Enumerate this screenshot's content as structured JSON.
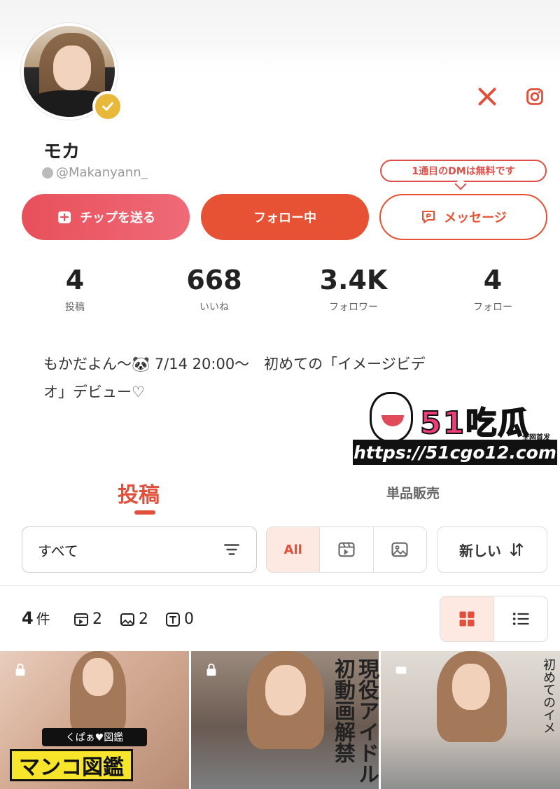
{
  "profile": {
    "name": "モカ",
    "handle": "@Makanyann_",
    "verified": true
  },
  "social": {
    "x_icon": "x-logo-icon",
    "instagram_icon": "instagram-icon"
  },
  "message_tooltip": "1通目のDMは無料です",
  "actions": {
    "tip_label": "チップを送る",
    "follow_label": "フォロー中",
    "message_label": "メッセージ"
  },
  "stats": [
    {
      "value": "4",
      "label": "投稿"
    },
    {
      "value": "668",
      "label": "いいね"
    },
    {
      "value": "3.4K",
      "label": "フォロワー"
    },
    {
      "value": "4",
      "label": "フォロー"
    }
  ],
  "bio": {
    "line1": "もかだよん〜🐼 7/14 20:00〜　初めての「イメージビデ",
    "line2": "オ」デビュー♡"
  },
  "watermark": {
    "title": "51吃瓜",
    "tag": "全网首发",
    "url": "https://51cgo12.com"
  },
  "tabs": {
    "posts": "投稿",
    "sales": "単品販売"
  },
  "filters": {
    "select_value": "すべて",
    "all_label": "All",
    "order_label": "新しい"
  },
  "summary": {
    "count": "4",
    "count_unit": "件",
    "video_count": "2",
    "image_count": "2",
    "text_count": "0"
  },
  "thumbnails": {
    "t1_caption": "マンコ図鑑",
    "t1_sub": "くぱぁ♥図鑑",
    "t2_caption": "現役アイドル初動画解禁",
    "t3_caption": "初めてのイメ"
  },
  "colors": {
    "accent": "#e85234",
    "tip_gradient_start": "#e8505a",
    "tip_gradient_end": "#ef6a78",
    "verified_gold": "#e8b83a"
  }
}
